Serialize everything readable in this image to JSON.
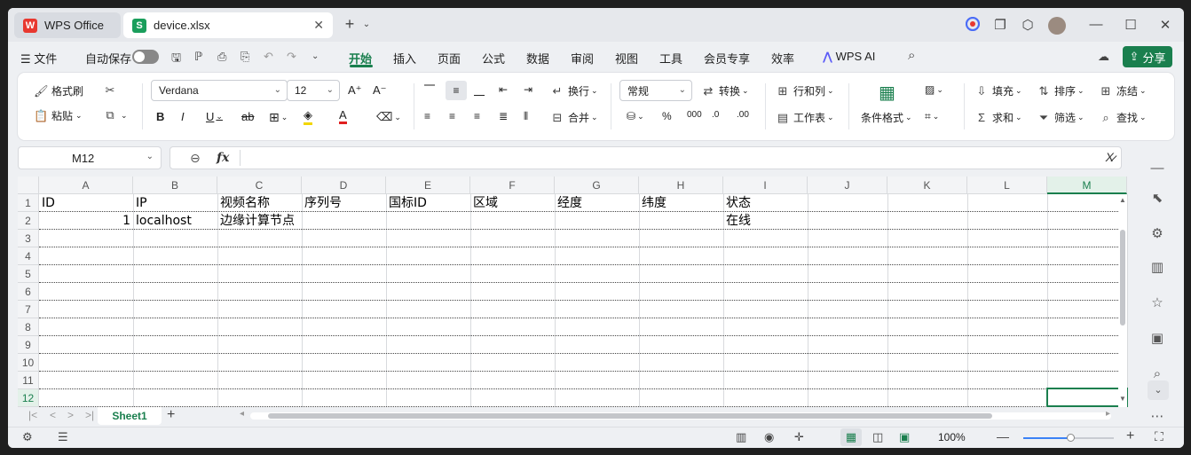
{
  "tabs": [
    {
      "label": "WPS Office",
      "icon": "wps-logo-icon",
      "color": "#e8382f"
    },
    {
      "label": "device.xlsx",
      "icon": "spreadsheet-icon",
      "color": "#1a9e5c"
    }
  ],
  "menu": {
    "file_label": "文件",
    "autosave_label": "自动保存",
    "items": [
      "开始",
      "插入",
      "页面",
      "公式",
      "数据",
      "审阅",
      "视图",
      "工具",
      "会员专享",
      "效率"
    ],
    "ai_label": "WPS AI",
    "share_label": "分享"
  },
  "ribbon": {
    "format_painter": "格式刷",
    "paste": "粘贴",
    "font_name": "Verdana",
    "font_size": "12",
    "wrap": "换行",
    "merge": "合并",
    "number_format": "常规",
    "convert": "转换",
    "rows_cols": "行和列",
    "worksheet": "工作表",
    "cond_format": "条件格式",
    "fill": "填充",
    "sort": "排序",
    "freeze": "冻结",
    "sum": "求和",
    "filter": "筛选",
    "find": "查找"
  },
  "formula": {
    "cell_ref": "M12",
    "fx_label": "fx",
    "value": ""
  },
  "columns": [
    "A",
    "B",
    "C",
    "D",
    "E",
    "F",
    "G",
    "H",
    "I",
    "J",
    "K",
    "L",
    "M"
  ],
  "rows": [
    "1",
    "2",
    "3",
    "4",
    "5",
    "6",
    "7",
    "8",
    "9",
    "10",
    "11",
    "12"
  ],
  "cells": {
    "r1": [
      "ID",
      "IP",
      "视频名称",
      "序列号",
      "国标ID",
      "区域",
      "经度",
      "纬度",
      "状态"
    ],
    "r2": {
      "a": "1",
      "b": "localhost",
      "c": "边缘计算节点",
      "i": "在线"
    }
  },
  "sheet_tab": "Sheet1",
  "status": {
    "zoom": "100%"
  },
  "colors": {
    "accent": "#1a7f4e"
  }
}
